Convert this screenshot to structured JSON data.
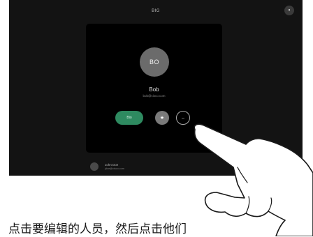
{
  "screen": {
    "top_title": "BIG",
    "corner_button_glyph": "⏸"
  },
  "contact": {
    "initials": "BO",
    "name": "Bob",
    "email": "bob@cisco.com",
    "call_label": "Bio",
    "favorite_icon": "star-icon",
    "more_icon": "more-icon"
  },
  "list_item": {
    "name": "John Doe",
    "sub": "jdoe@cisco.com"
  },
  "caption": {
    "text": "点击要编辑的人员，然后点击他们"
  },
  "colors": {
    "screen_bg": "#131313",
    "card_bg": "#000000",
    "call_green": "#2e8a60",
    "avatar_gray": "#6b6b6b"
  }
}
